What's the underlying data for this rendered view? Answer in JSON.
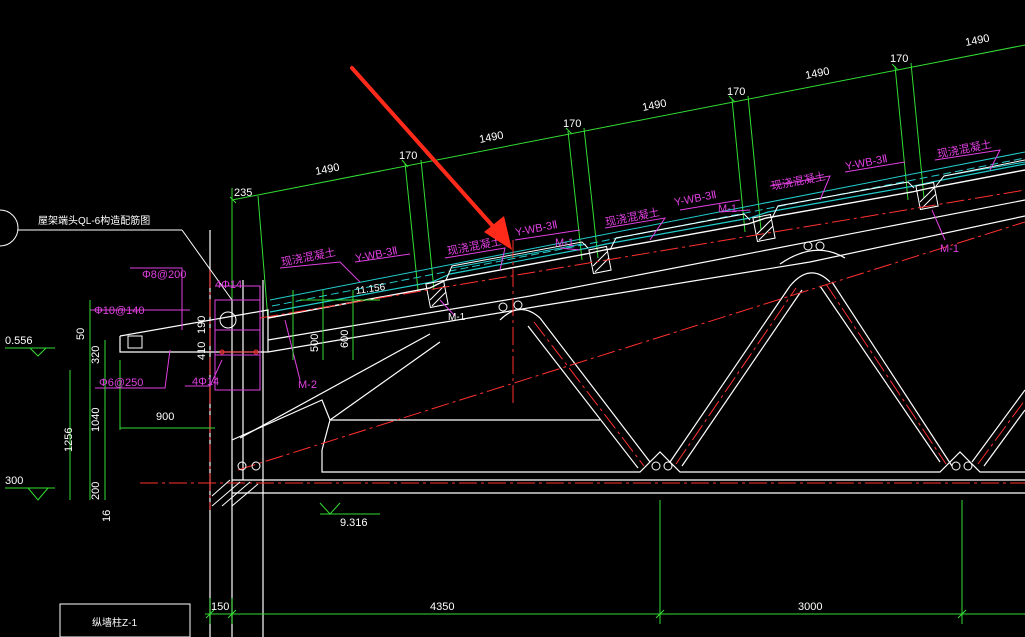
{
  "colors": {
    "background": "#000000",
    "structure": "#ffffff",
    "dimension": "#33dd33",
    "annotation": "#e040e0",
    "centerline": "#ff3030",
    "slab": "#22cccc",
    "arrow": "#ff2a1a"
  },
  "roof_dims": {
    "first": "235",
    "segments": [
      "1490",
      "170",
      "1490",
      "170",
      "1490",
      "170",
      "1490",
      "170",
      "1490"
    ]
  },
  "slab_labels": {
    "cast_in_place": "现浇混凝土",
    "panel": "Y-WB-3Ⅱ",
    "joint": "M-1",
    "joint_lower": "M-2"
  },
  "left_detail": {
    "title": "屋架端头QL-6构造配筋图",
    "rebar_top": "Φ8@200",
    "rebar_mid": "Φ10@140",
    "rebar_bottom": "Φ6@250",
    "rebar_4phi14_a": "4Φ14",
    "rebar_4phi14_b": "4Φ14",
    "dim_50": "50",
    "dim_320": "320",
    "dim_1040": "1040",
    "dim_1256": "1256",
    "dim_200": "200",
    "dim_16": "16",
    "dim_900": "900",
    "dim_410": "410",
    "dim_190": "190",
    "dim_500": "500",
    "dim_600": "600"
  },
  "elevations": {
    "top_left": "0.556",
    "bottom_left": "300",
    "bottom_chord": "9.316",
    "slab_level": "11.156"
  },
  "bottom_dims": {
    "d150": "150",
    "d4350": "4350",
    "d3000": "3000"
  },
  "column_label": "纵墙柱Z-1"
}
